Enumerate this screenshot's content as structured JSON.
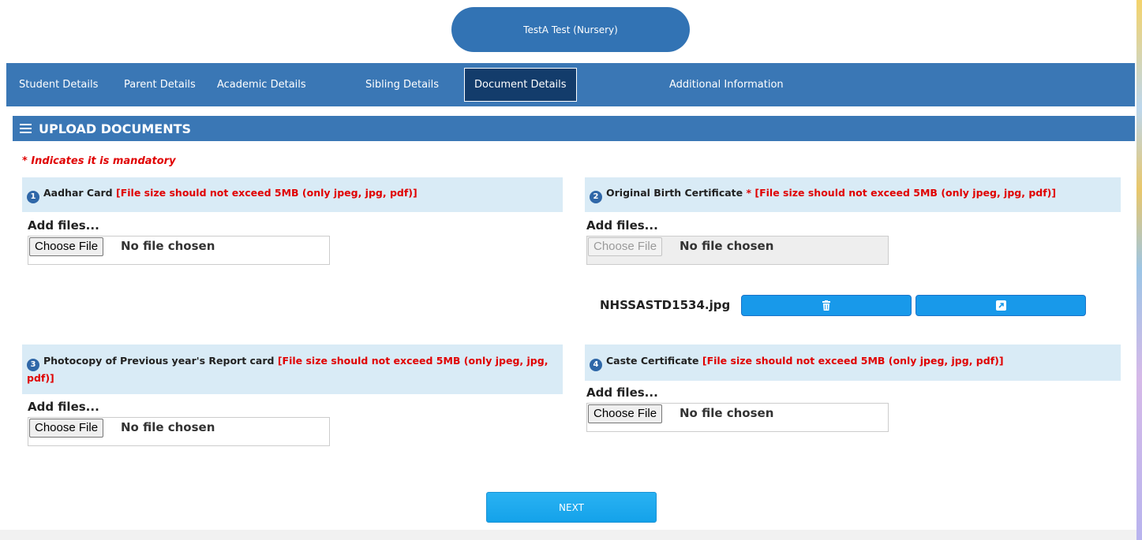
{
  "student": {
    "title": "TestA Test (Nursery)"
  },
  "tabs": [
    {
      "label": "Student Details"
    },
    {
      "label": "Parent Details"
    },
    {
      "label": "Academic Details"
    },
    {
      "label": "Sibling Details"
    },
    {
      "label": "Document Details",
      "active": true
    },
    {
      "label": "Additional Information"
    }
  ],
  "section": {
    "title": "UPLOAD DOCUMENTS"
  },
  "mandatory_note": "* Indicates it is mandatory",
  "documents": [
    {
      "number": "1",
      "name": "Aadhar Card",
      "required": "",
      "rule": "[File size should not exceed 5MB (only jpeg, jpg, pdf)]",
      "add_files": "Add files...",
      "choose_label": "Choose File",
      "status": "No file chosen"
    },
    {
      "number": "2",
      "name": "Original Birth Certificate",
      "required": "*",
      "rule": "[File size should not exceed 5MB (only jpeg, jpg, pdf)]",
      "add_files": "Add files...",
      "choose_label": "Choose File",
      "status": "No file chosen",
      "uploaded_file": "NHSSASTD1534.jpg"
    },
    {
      "number": "3",
      "name": "Photocopy of Previous year's Report card",
      "required": "",
      "rule": "[File size should not exceed 5MB (only jpeg, jpg, pdf)]",
      "add_files": "Add files...",
      "choose_label": "Choose File",
      "status": "No file chosen"
    },
    {
      "number": "4",
      "name": "Caste Certificate",
      "required": "",
      "rule": "[File size should not exceed 5MB (only jpeg, jpg, pdf)]",
      "add_files": "Add files...",
      "choose_label": "Choose File",
      "status": "No file chosen"
    }
  ],
  "icons": {
    "delete": "trash-icon",
    "open": "external-link-icon",
    "menu": "hamburger-icon"
  },
  "colors": {
    "header_blue": "#3a77b5",
    "active_tab": "#133c6b",
    "button_blue": "#1899ea",
    "warning_red": "#e00000"
  },
  "next_label": "NEXT"
}
